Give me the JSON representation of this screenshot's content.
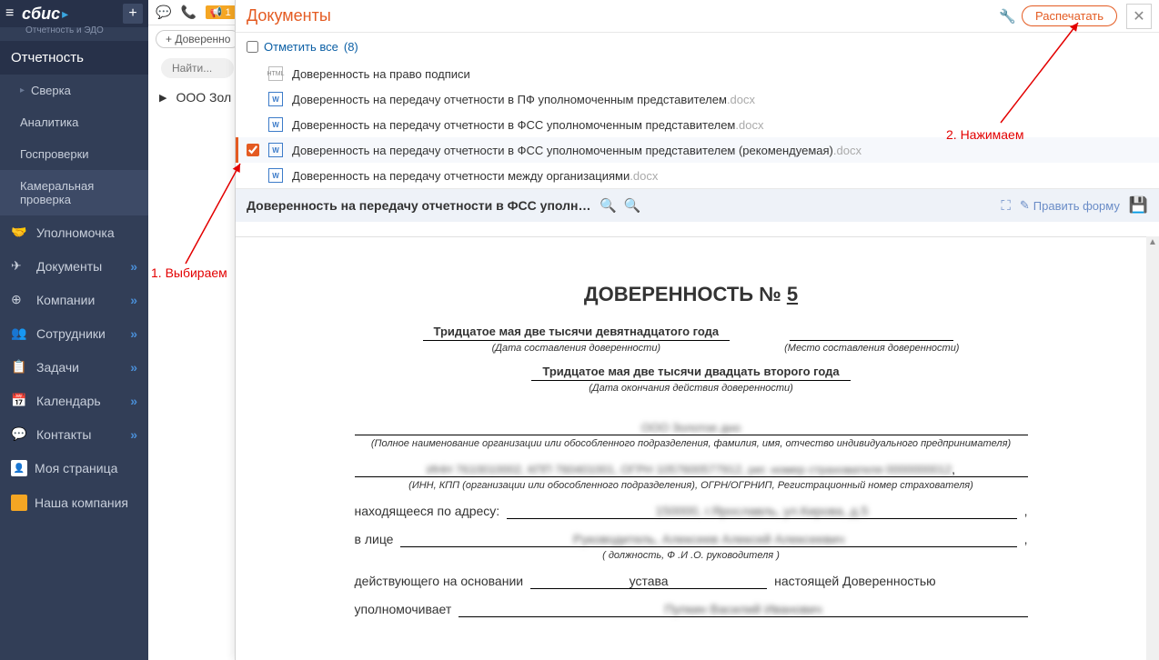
{
  "sidebar": {
    "logo_text": "сбис",
    "logo_sub": "Отчетность и ЭДО",
    "section": "Отчетность",
    "items": [
      {
        "label": "Сверка",
        "icon": "",
        "caret": true,
        "chevron": false,
        "sub": true
      },
      {
        "label": "Аналитика",
        "icon": "",
        "sub": true
      },
      {
        "label": "Госпроверки",
        "icon": "",
        "sub": true
      },
      {
        "label": "Камеральная проверка",
        "icon": "",
        "sub": true,
        "active": true
      },
      {
        "label": "Уполномочка",
        "icon": "🤝"
      },
      {
        "label": "Документы",
        "icon": "✈",
        "chevron": true
      },
      {
        "label": "Компании",
        "icon": "⊕",
        "chevron": true
      },
      {
        "label": "Сотрудники",
        "icon": "👥",
        "chevron": true
      },
      {
        "label": "Задачи",
        "icon": "📋",
        "chevron": true
      },
      {
        "label": "Календарь",
        "icon": "📅",
        "chevron": true
      },
      {
        "label": "Контакты",
        "icon": "💬",
        "chevron": true
      },
      {
        "label": "Моя страница",
        "avatar": "man"
      },
      {
        "label": "Наша компания",
        "avatar": "orange"
      }
    ]
  },
  "topstrip": {
    "badge_count": "1"
  },
  "secondrow": {
    "add_btn": "+ Доверенно",
    "search_placeholder": "Найти..."
  },
  "list": {
    "item": "ООО Зол"
  },
  "panel": {
    "title": "Документы",
    "print_btn": "Распечатать",
    "mark_all_label": "Отметить все",
    "mark_all_count": "(8)",
    "docs": [
      {
        "type": "html",
        "name": "Доверенность на право подписи",
        "ext": ""
      },
      {
        "type": "word",
        "name": "Доверенность на передачу отчетности в ПФ уполномоченным представителем",
        "ext": ".docx"
      },
      {
        "type": "word",
        "name": "Доверенность на передачу отчетности в ФСС уполномоченным представителем",
        "ext": ".docx"
      },
      {
        "type": "word",
        "name": "Доверенность на передачу отчетности в ФСС уполномоченным представителем (рекомендуемая)",
        "ext": ".docx",
        "selected": true
      },
      {
        "type": "word",
        "name": "Доверенность на передачу отчетности между организациями",
        "ext": ".docx"
      }
    ],
    "preview_title": "Доверенность на передачу отчетности в ФСС уполномоченным пре...",
    "edit_form": "Править форму"
  },
  "doc": {
    "title_pref": "ДОВЕРЕННОСТЬ № ",
    "title_num": "5",
    "date1": "Тридцатое мая две тысячи девятнадцатого года",
    "date1_cap": "(Дата составления доверенности)",
    "place_cap": "(Место составления доверенности)",
    "date2": "Тридцатое мая две тысячи двадцать второго года",
    "date2_cap": "(Дата окончания действия доверенности)",
    "org_blur": "ООО Золотое дно",
    "org_cap": "(Полное наименование организации или обособленного подразделения, фамилия, имя, отчество индивидуального предпринимателя)",
    "inn_blur": "ИНН 7610010002, КПП 760401001, ОГРН 1057600577912, рег. номер страхователя 0000000012",
    "inn_cap": "(ИНН, КПП (организации или обособленного подразделения), ОГРН/ОГРНИП, Регистрационный номер страхователя)",
    "addr_label": "находящееся по адресу:",
    "addr_blur": "150000, г.Ярославль, ул.Кирова, д.5",
    "face_label": "в лице",
    "face_blur": "Руководитель, Алексеев Алексей Алексеевич",
    "face_cap": "( должность, Ф .И .О. руководителя )",
    "basis_label": "действующего на основании",
    "basis_val": "устава",
    "basis_suffix": "настоящей Доверенностью",
    "auth_label": "уполномочивает",
    "auth_blur": "Пупкин Василий Иванович"
  },
  "anno": {
    "a1": "1. Выбираем",
    "a2": "2. Нажимаем"
  }
}
